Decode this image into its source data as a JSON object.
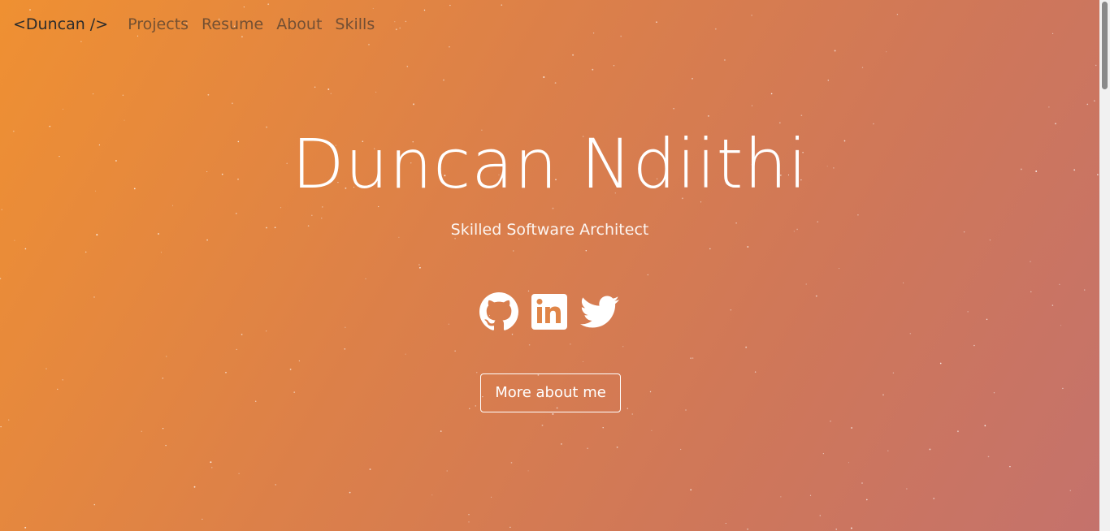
{
  "nav": {
    "brand": "<Duncan />",
    "links": [
      "Projects",
      "Resume",
      "About",
      "Skills"
    ]
  },
  "hero": {
    "name": "Duncan Ndiithi",
    "subtitle": "Skilled Software Architect",
    "cta_label": "More about me"
  },
  "socials": [
    {
      "icon": "github-icon"
    },
    {
      "icon": "linkedin-icon"
    },
    {
      "icon": "twitter-icon"
    }
  ],
  "colors": {
    "gradient_start": "#ef9032",
    "gradient_end": "#c4726c",
    "text_light": "#ffffff",
    "brand_text": "#2c2c2c"
  }
}
